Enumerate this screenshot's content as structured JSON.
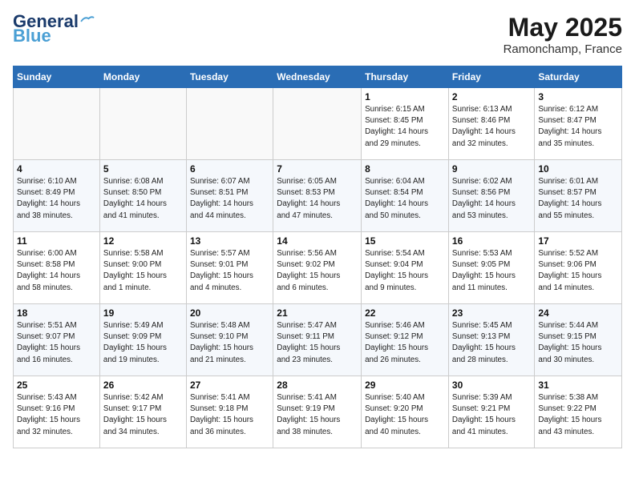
{
  "header": {
    "logo_line1": "General",
    "logo_line2": "Blue",
    "month_year": "May 2025",
    "location": "Ramonchamp, France"
  },
  "weekdays": [
    "Sunday",
    "Monday",
    "Tuesday",
    "Wednesday",
    "Thursday",
    "Friday",
    "Saturday"
  ],
  "weeks": [
    [
      {
        "day": "",
        "info": ""
      },
      {
        "day": "",
        "info": ""
      },
      {
        "day": "",
        "info": ""
      },
      {
        "day": "",
        "info": ""
      },
      {
        "day": "1",
        "info": "Sunrise: 6:15 AM\nSunset: 8:45 PM\nDaylight: 14 hours\nand 29 minutes."
      },
      {
        "day": "2",
        "info": "Sunrise: 6:13 AM\nSunset: 8:46 PM\nDaylight: 14 hours\nand 32 minutes."
      },
      {
        "day": "3",
        "info": "Sunrise: 6:12 AM\nSunset: 8:47 PM\nDaylight: 14 hours\nand 35 minutes."
      }
    ],
    [
      {
        "day": "4",
        "info": "Sunrise: 6:10 AM\nSunset: 8:49 PM\nDaylight: 14 hours\nand 38 minutes."
      },
      {
        "day": "5",
        "info": "Sunrise: 6:08 AM\nSunset: 8:50 PM\nDaylight: 14 hours\nand 41 minutes."
      },
      {
        "day": "6",
        "info": "Sunrise: 6:07 AM\nSunset: 8:51 PM\nDaylight: 14 hours\nand 44 minutes."
      },
      {
        "day": "7",
        "info": "Sunrise: 6:05 AM\nSunset: 8:53 PM\nDaylight: 14 hours\nand 47 minutes."
      },
      {
        "day": "8",
        "info": "Sunrise: 6:04 AM\nSunset: 8:54 PM\nDaylight: 14 hours\nand 50 minutes."
      },
      {
        "day": "9",
        "info": "Sunrise: 6:02 AM\nSunset: 8:56 PM\nDaylight: 14 hours\nand 53 minutes."
      },
      {
        "day": "10",
        "info": "Sunrise: 6:01 AM\nSunset: 8:57 PM\nDaylight: 14 hours\nand 55 minutes."
      }
    ],
    [
      {
        "day": "11",
        "info": "Sunrise: 6:00 AM\nSunset: 8:58 PM\nDaylight: 14 hours\nand 58 minutes."
      },
      {
        "day": "12",
        "info": "Sunrise: 5:58 AM\nSunset: 9:00 PM\nDaylight: 15 hours\nand 1 minute."
      },
      {
        "day": "13",
        "info": "Sunrise: 5:57 AM\nSunset: 9:01 PM\nDaylight: 15 hours\nand 4 minutes."
      },
      {
        "day": "14",
        "info": "Sunrise: 5:56 AM\nSunset: 9:02 PM\nDaylight: 15 hours\nand 6 minutes."
      },
      {
        "day": "15",
        "info": "Sunrise: 5:54 AM\nSunset: 9:04 PM\nDaylight: 15 hours\nand 9 minutes."
      },
      {
        "day": "16",
        "info": "Sunrise: 5:53 AM\nSunset: 9:05 PM\nDaylight: 15 hours\nand 11 minutes."
      },
      {
        "day": "17",
        "info": "Sunrise: 5:52 AM\nSunset: 9:06 PM\nDaylight: 15 hours\nand 14 minutes."
      }
    ],
    [
      {
        "day": "18",
        "info": "Sunrise: 5:51 AM\nSunset: 9:07 PM\nDaylight: 15 hours\nand 16 minutes."
      },
      {
        "day": "19",
        "info": "Sunrise: 5:49 AM\nSunset: 9:09 PM\nDaylight: 15 hours\nand 19 minutes."
      },
      {
        "day": "20",
        "info": "Sunrise: 5:48 AM\nSunset: 9:10 PM\nDaylight: 15 hours\nand 21 minutes."
      },
      {
        "day": "21",
        "info": "Sunrise: 5:47 AM\nSunset: 9:11 PM\nDaylight: 15 hours\nand 23 minutes."
      },
      {
        "day": "22",
        "info": "Sunrise: 5:46 AM\nSunset: 9:12 PM\nDaylight: 15 hours\nand 26 minutes."
      },
      {
        "day": "23",
        "info": "Sunrise: 5:45 AM\nSunset: 9:13 PM\nDaylight: 15 hours\nand 28 minutes."
      },
      {
        "day": "24",
        "info": "Sunrise: 5:44 AM\nSunset: 9:15 PM\nDaylight: 15 hours\nand 30 minutes."
      }
    ],
    [
      {
        "day": "25",
        "info": "Sunrise: 5:43 AM\nSunset: 9:16 PM\nDaylight: 15 hours\nand 32 minutes."
      },
      {
        "day": "26",
        "info": "Sunrise: 5:42 AM\nSunset: 9:17 PM\nDaylight: 15 hours\nand 34 minutes."
      },
      {
        "day": "27",
        "info": "Sunrise: 5:41 AM\nSunset: 9:18 PM\nDaylight: 15 hours\nand 36 minutes."
      },
      {
        "day": "28",
        "info": "Sunrise: 5:41 AM\nSunset: 9:19 PM\nDaylight: 15 hours\nand 38 minutes."
      },
      {
        "day": "29",
        "info": "Sunrise: 5:40 AM\nSunset: 9:20 PM\nDaylight: 15 hours\nand 40 minutes."
      },
      {
        "day": "30",
        "info": "Sunrise: 5:39 AM\nSunset: 9:21 PM\nDaylight: 15 hours\nand 41 minutes."
      },
      {
        "day": "31",
        "info": "Sunrise: 5:38 AM\nSunset: 9:22 PM\nDaylight: 15 hours\nand 43 minutes."
      }
    ]
  ]
}
